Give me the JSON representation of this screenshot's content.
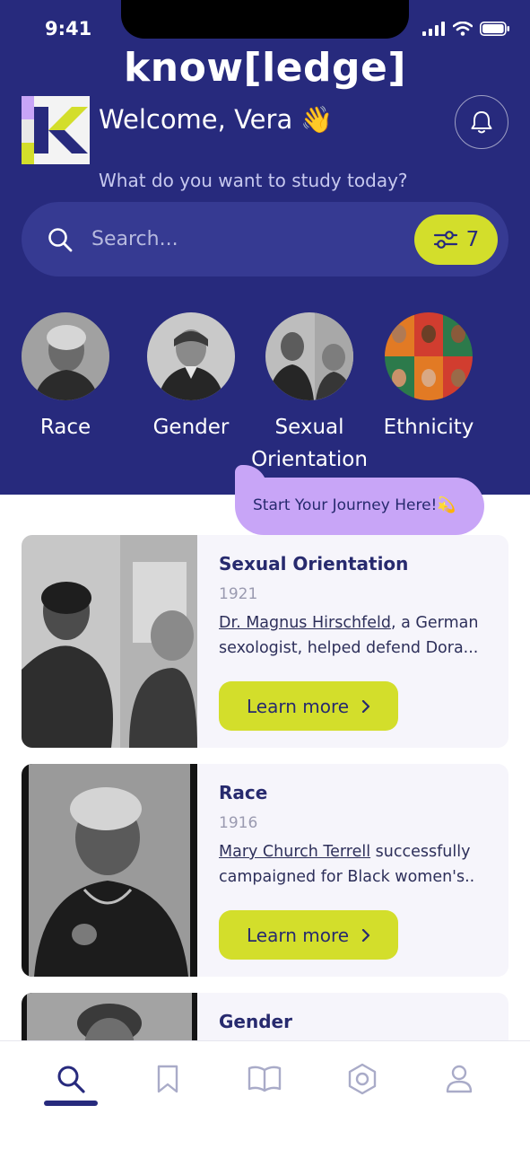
{
  "status_bar": {
    "time": "9:41"
  },
  "brand": {
    "name": "know[ledge]"
  },
  "header": {
    "welcome": "Welcome, Vera 👋",
    "subtitle": "What do you want to study today?"
  },
  "search": {
    "placeholder": "Search...",
    "filter_count": "7"
  },
  "categories": [
    {
      "label": "Race"
    },
    {
      "label": "Gender"
    },
    {
      "label": "Sexual Orientation"
    },
    {
      "label": "Ethnicity"
    }
  ],
  "tooltip": {
    "text": "Start Your Journey Here!💫"
  },
  "cards": [
    {
      "title": "Sexual Orientation",
      "year": "1921",
      "link": "Dr. Magnus Hirschfeld",
      "desc": ", a German sexologist, helped defend Dora...",
      "button": "Learn more"
    },
    {
      "title": "Race",
      "year": "1916",
      "link": "Mary Church Terrell",
      "desc": " successfully campaigned for Black women's..",
      "button": "Learn more"
    },
    {
      "title": "Gender",
      "year": "",
      "link": "",
      "desc": "",
      "button": ""
    }
  ],
  "tabbar": {
    "active": "search",
    "items": [
      "search-icon",
      "bookmark-icon",
      "book-icon",
      "hexagon-icon",
      "profile-icon"
    ]
  },
  "colors": {
    "header_bg": "#272a7d",
    "accent_lime": "#d3de2b",
    "tooltip_purple": "#c8a5f7",
    "card_bg": "#f6f5fb"
  }
}
